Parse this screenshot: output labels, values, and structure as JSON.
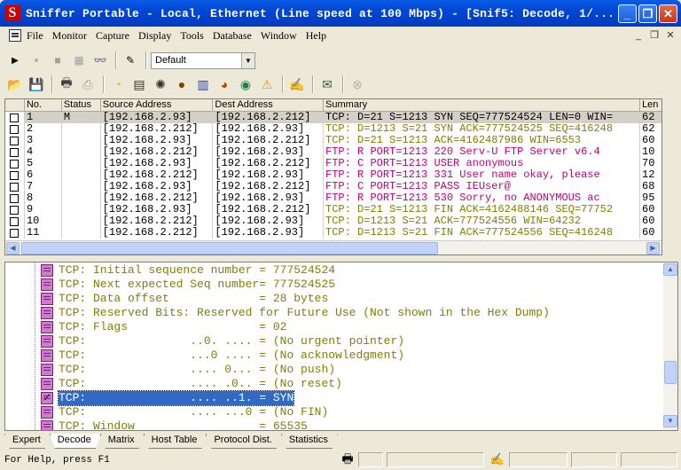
{
  "window": {
    "title": "Sniffer Portable - Local, Ethernet (Line speed at 100 Mbps) - [Snif5: Decode, 1/...",
    "app_icon": "S",
    "controls": [
      "_",
      "❐",
      "✕"
    ]
  },
  "menu": [
    "File",
    "Monitor",
    "Capture",
    "Display",
    "Tools",
    "Database",
    "Window",
    "Help"
  ],
  "mdi_controls": [
    "_",
    "❐",
    "✕"
  ],
  "toolbar1": {
    "buttons": [
      {
        "name": "play-icon",
        "glyph": "▶"
      },
      {
        "name": "pause-icon",
        "glyph": "⏸"
      },
      {
        "name": "stop-icon",
        "glyph": "■"
      },
      {
        "name": "stop-display-icon",
        "glyph": "▦"
      },
      {
        "name": "binoculars-icon",
        "glyph": "👓"
      },
      {
        "name": "filter-define-icon",
        "glyph": "✎"
      }
    ],
    "profile_select": "Default"
  },
  "toolbar2": {
    "buttons": [
      {
        "name": "open-icon",
        "glyph": "📂",
        "color": "#d8b040"
      },
      {
        "name": "save-icon",
        "glyph": "💾",
        "color": "#203080"
      },
      {
        "name": "print-icon",
        "glyph": "🖶",
        "color": "#404040"
      },
      {
        "name": "print-setup-icon",
        "glyph": "⎙",
        "color": "#a0a0a0"
      },
      {
        "name": "dashboard-icon",
        "glyph": "◔",
        "color": "#e0c000"
      },
      {
        "name": "host-table-icon",
        "glyph": "▤",
        "color": "#303030"
      },
      {
        "name": "matrix-icon",
        "glyph": "✺",
        "color": "#303030"
      },
      {
        "name": "application-response-icon",
        "glyph": "●",
        "color": "#804000"
      },
      {
        "name": "history-samples-icon",
        "glyph": "▥",
        "color": "#2040c0"
      },
      {
        "name": "protocol-distribution-icon",
        "glyph": "◕",
        "color": "#c04000"
      },
      {
        "name": "global-statistics-icon",
        "glyph": "◉",
        "color": "#208040"
      },
      {
        "name": "alarm-log-icon",
        "glyph": "⚠",
        "color": "#e0a000"
      },
      {
        "name": "expert-icon",
        "glyph": "✍",
        "color": "#800000"
      },
      {
        "name": "address-book-icon",
        "glyph": "✉",
        "color": "#406040"
      },
      {
        "name": "disabled-icon",
        "glyph": "⊗",
        "color": "#b0b0b0"
      }
    ]
  },
  "packet_list": {
    "columns": [
      "No.",
      "Status",
      "Source Address",
      "Dest Address",
      "Summary",
      "Len"
    ],
    "rows": [
      {
        "no": "1",
        "status": "M",
        "src": "[192.168.2.93]",
        "dst": "[192.168.2.212]",
        "summary": "TCP: D=21 S=1213 SYN SEQ=777524524 LEN=0 WIN=",
        "len": "62",
        "color": "#000000",
        "selected": true
      },
      {
        "no": "2",
        "status": "",
        "src": "[192.168.2.212]",
        "dst": "[192.168.2.93]",
        "summary": "TCP: D=1213 S=21 SYN ACK=777524525 SEQ=416248",
        "len": "62",
        "color": "#808000",
        "selected": false
      },
      {
        "no": "3",
        "status": "",
        "src": "[192.168.2.93]",
        "dst": "[192.168.2.212]",
        "summary": "TCP: D=21 S=1213     ACK=4162487986 WIN=6553",
        "len": "60",
        "color": "#808000",
        "selected": false
      },
      {
        "no": "4",
        "status": "",
        "src": "[192.168.2.212]",
        "dst": "[192.168.2.93]",
        "summary": "FTP: R PORT=1213   220 Serv-U FTP Server v6.4",
        "len": "10",
        "color": "#c00080",
        "selected": false
      },
      {
        "no": "5",
        "status": "",
        "src": "[192.168.2.93]",
        "dst": "[192.168.2.212]",
        "summary": "FTP: C PORT=1213   USER anonymous",
        "len": "70",
        "color": "#c00080",
        "selected": false
      },
      {
        "no": "6",
        "status": "",
        "src": "[192.168.2.212]",
        "dst": "[192.168.2.93]",
        "summary": "FTP: R PORT=1213   331 User name okay, please",
        "len": "12",
        "color": "#c00080",
        "selected": false
      },
      {
        "no": "7",
        "status": "",
        "src": "[192.168.2.93]",
        "dst": "[192.168.2.212]",
        "summary": "FTP: C PORT=1213   PASS IEUser@",
        "len": "68",
        "color": "#c00080",
        "selected": false
      },
      {
        "no": "8",
        "status": "",
        "src": "[192.168.2.212]",
        "dst": "[192.168.2.93]",
        "summary": "FTP: R PORT=1213   530 Sorry, no ANONYMOUS ac",
        "len": "95",
        "color": "#c00080",
        "selected": false
      },
      {
        "no": "9",
        "status": "",
        "src": "[192.168.2.93]",
        "dst": "[192.168.2.212]",
        "summary": "TCP: D=21 S=1213 FIN ACK=4162488146 SEQ=77752",
        "len": "60",
        "color": "#808000",
        "selected": false
      },
      {
        "no": "10",
        "status": "",
        "src": "[192.168.2.212]",
        "dst": "[192.168.2.93]",
        "summary": "TCP: D=1213 S=21     ACK=777524556 WIN=64232",
        "len": "60",
        "color": "#808000",
        "selected": false
      },
      {
        "no": "11",
        "status": "",
        "src": "[192.168.2.212]",
        "dst": "[192.168.2.93]",
        "summary": "TCP: D=1213 S=21 FIN ACK=777524556 SEQ=416248",
        "len": "60",
        "color": "#808000",
        "selected": false
      }
    ]
  },
  "decode": {
    "lines": [
      {
        "text": "TCP: Initial sequence number = 777524524",
        "checked": false,
        "selected": false
      },
      {
        "text": "TCP: Next expected Seq number= 777524525",
        "checked": false,
        "selected": false
      },
      {
        "text": "TCP: Data offset             = 28 bytes",
        "checked": false,
        "selected": false
      },
      {
        "text": "TCP: Reserved Bits: Reserved for Future Use (Not shown in the Hex Dump)",
        "checked": false,
        "selected": false
      },
      {
        "text": "TCP: Flags                   = 02",
        "checked": false,
        "selected": false
      },
      {
        "text": "TCP:               ..0. .... = (No urgent pointer)",
        "checked": false,
        "selected": false
      },
      {
        "text": "TCP:               ...0 .... = (No acknowledgment)",
        "checked": false,
        "selected": false
      },
      {
        "text": "TCP:               .... 0... = (No push)",
        "checked": false,
        "selected": false
      },
      {
        "text": "TCP:               .... .0.. = (No reset)",
        "checked": false,
        "selected": false
      },
      {
        "text": "TCP:               .... ..1. = SYN",
        "checked": true,
        "selected": true
      },
      {
        "text": "TCP:               .... ...0 = (No FIN)",
        "checked": false,
        "selected": false
      },
      {
        "text": "TCP: Window                  = 65535",
        "checked": false,
        "selected": false
      }
    ]
  },
  "tabs": [
    {
      "label": "Expert",
      "active": false
    },
    {
      "label": "Decode",
      "active": true
    },
    {
      "label": "Matrix",
      "active": false
    },
    {
      "label": "Host Table",
      "active": false
    },
    {
      "label": "Protocol Dist.",
      "active": false
    },
    {
      "label": "Statistics",
      "active": false
    }
  ],
  "status": {
    "text": "For Help, press F1"
  }
}
